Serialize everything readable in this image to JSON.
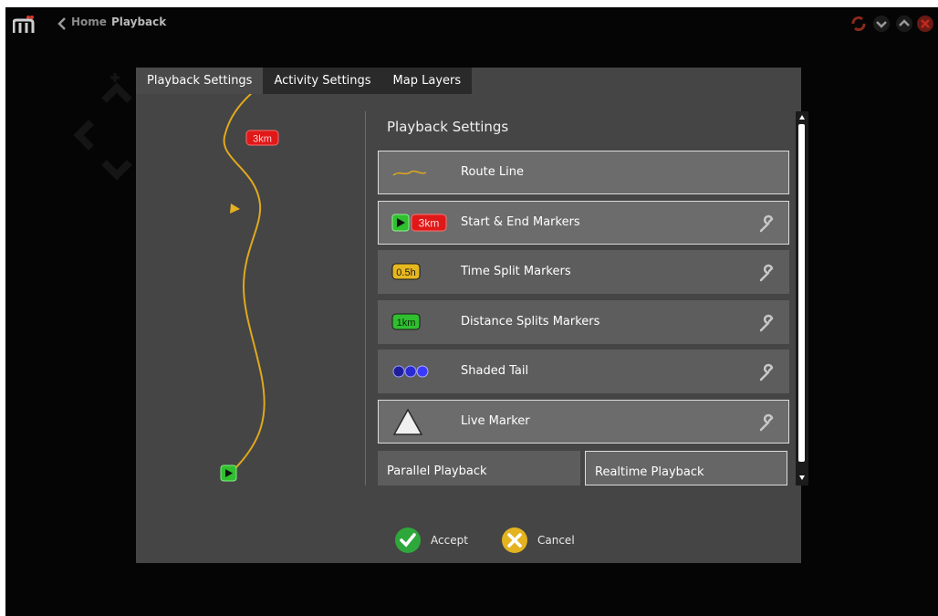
{
  "topbar": {
    "home_label": "Home",
    "page_label": "Playback"
  },
  "tabs": [
    {
      "label": "Playback Settings",
      "active": true
    },
    {
      "label": "Activity Settings",
      "active": false
    },
    {
      "label": "Map Layers",
      "active": false
    }
  ],
  "preview": {
    "end_marker_text": "3km"
  },
  "panel": {
    "title": "Playback Settings",
    "items": [
      {
        "label": "Route Line",
        "icon": "route-line-icon",
        "has_settings": false,
        "selected": true
      },
      {
        "label": "Start & End Markers",
        "icon": "start-end-marker-icon",
        "icon_text": "3km",
        "has_settings": true,
        "selected": true
      },
      {
        "label": "Time Split Markers",
        "icon": "time-split-marker-icon",
        "icon_text": "0.5h",
        "has_settings": true,
        "selected": false
      },
      {
        "label": "Distance Splits Markers",
        "icon": "distance-split-marker-icon",
        "icon_text": "1km",
        "has_settings": true,
        "selected": false
      },
      {
        "label": "Shaded Tail",
        "icon": "shaded-tail-icon",
        "has_settings": true,
        "selected": false
      },
      {
        "label": "Live Marker",
        "icon": "live-marker-icon",
        "has_settings": true,
        "selected": true
      }
    ],
    "parallel_label": "Parallel Playback",
    "realtime_label": "Realtime Playback"
  },
  "footer": {
    "accept_label": "Accept",
    "cancel_label": "Cancel"
  },
  "colors": {
    "route": "#e0a81c",
    "start_green": "#2fbf2f",
    "end_red": "#e01818",
    "time_badge": "#e6b820",
    "accept_green": "#2ea83a",
    "cancel_yellow": "#e3b320"
  }
}
